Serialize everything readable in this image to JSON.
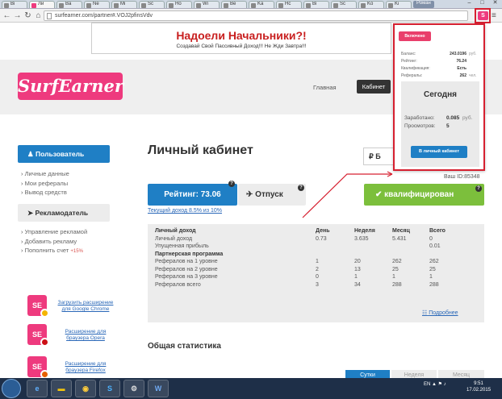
{
  "browser": {
    "tabs": [
      {
        "label": "Bi",
        "active": false
      },
      {
        "label": "Ли",
        "active": true
      },
      {
        "label": "Ba",
        "active": false
      },
      {
        "label": "Ne",
        "active": false
      },
      {
        "label": "Mi",
        "active": false
      },
      {
        "label": "Sc",
        "active": false
      },
      {
        "label": "Ho",
        "active": false
      },
      {
        "label": "Wi",
        "active": false
      },
      {
        "label": "Be",
        "active": false
      },
      {
        "label": "Ka",
        "active": false
      },
      {
        "label": "Hc",
        "active": false
      },
      {
        "label": "Bi",
        "active": false
      },
      {
        "label": "Sc",
        "active": false
      },
      {
        "label": "Ko",
        "active": false
      },
      {
        "label": "Ki",
        "active": false
      }
    ],
    "profile": "Роман",
    "url": "surfearner.com/partner#.VOJ2pfinsVdv"
  },
  "promo": {
    "title": "Надоели Начальники?!",
    "subtitle": "Создавай Свой Пассивный Доход!!! Не Жди Завтра!!!"
  },
  "site": {
    "logo": "SurfEarner",
    "nav": {
      "home": "Главная",
      "cabinet": "Кабинет"
    }
  },
  "sidebar": {
    "user_button": "Пользователь",
    "user_links": [
      "Личные данные",
      "Мои рефералы",
      "Вывод средств"
    ],
    "adv_button": "Рекламодатель",
    "adv_links": [
      "Управление рекламой",
      "Добавить рекламу",
      "Пополнить счет"
    ],
    "adv_bonus": "+15%",
    "ext_promos": [
      {
        "label": "Загрузить расширение для Google Chrome",
        "icon": "chrome-logo"
      },
      {
        "label": "Расширение для браузера Opera",
        "icon": "opera-logo"
      },
      {
        "label": "Расширение для браузера Firefox",
        "icon": "firefox-logo"
      }
    ]
  },
  "main": {
    "title": "Личный кабинет",
    "balance_label": "Б",
    "user_id": "Ваш ID:85348",
    "rating_button": "Рейтинг: 73.06",
    "vacation_button": "Отпуск",
    "current_income": "Текущий доход 8.5% из 10%",
    "qual_button": "квалифицирован",
    "stats": {
      "headers": [
        "Личный доход",
        "День",
        "Неделя",
        "Месяц",
        "Всего"
      ],
      "rows": [
        {
          "label": "Личный доход",
          "values": [
            "0.73",
            "3.635",
            "5.431",
            "0"
          ],
          "type": "row"
        },
        {
          "label": "Упущенная прибыль",
          "values": [
            "",
            "",
            "",
            "0.01"
          ],
          "type": "row"
        },
        {
          "label": "Партнерская программа",
          "values": [
            "",
            "",
            "",
            ""
          ],
          "type": "sect"
        },
        {
          "label": "Рефералов на 1 уровне",
          "values": [
            "1",
            "20",
            "262",
            "262"
          ],
          "type": "row"
        },
        {
          "label": "Рефералов на 2 уровне",
          "values": [
            "2",
            "13",
            "25",
            "25"
          ],
          "type": "row"
        },
        {
          "label": "Рефералов на 3 уровне",
          "values": [
            "0",
            "1",
            "1",
            "1"
          ],
          "type": "row"
        },
        {
          "label": "Рефералов всего",
          "values": [
            "3",
            "34",
            "288",
            "288"
          ],
          "type": "row"
        }
      ],
      "details_link": "Подробнее"
    },
    "general_title": "Общая статистика",
    "period_tabs": [
      "Сутки",
      "Неделя",
      "Месяц"
    ]
  },
  "popup": {
    "status": "Включено",
    "rows": [
      {
        "label": "Баланс:",
        "value": "243.0196",
        "unit": "руб."
      },
      {
        "label": "Рейтинг:",
        "value": "76.24",
        "unit": ""
      },
      {
        "label": "Квалификация:",
        "value": "Есть",
        "unit": ""
      },
      {
        "label": "Рефералы:",
        "value": "262",
        "unit": "чел."
      }
    ],
    "today_title": "Сегодня",
    "today_rows": [
      {
        "label": "Заработано:",
        "value": "0.085",
        "unit": "руб."
      },
      {
        "label": "Просмотров:",
        "value": "5",
        "unit": ""
      }
    ],
    "cabinet_button": "В личный кабинет"
  },
  "taskbar": {
    "tray": "EN",
    "time": "9:51",
    "date": "17.02.2015"
  },
  "colors": {
    "brand_pink": "#ee3a7e",
    "primary_blue": "#1f7fc5",
    "qual_green": "#7cbf3c",
    "annotation_red": "#d62030"
  }
}
